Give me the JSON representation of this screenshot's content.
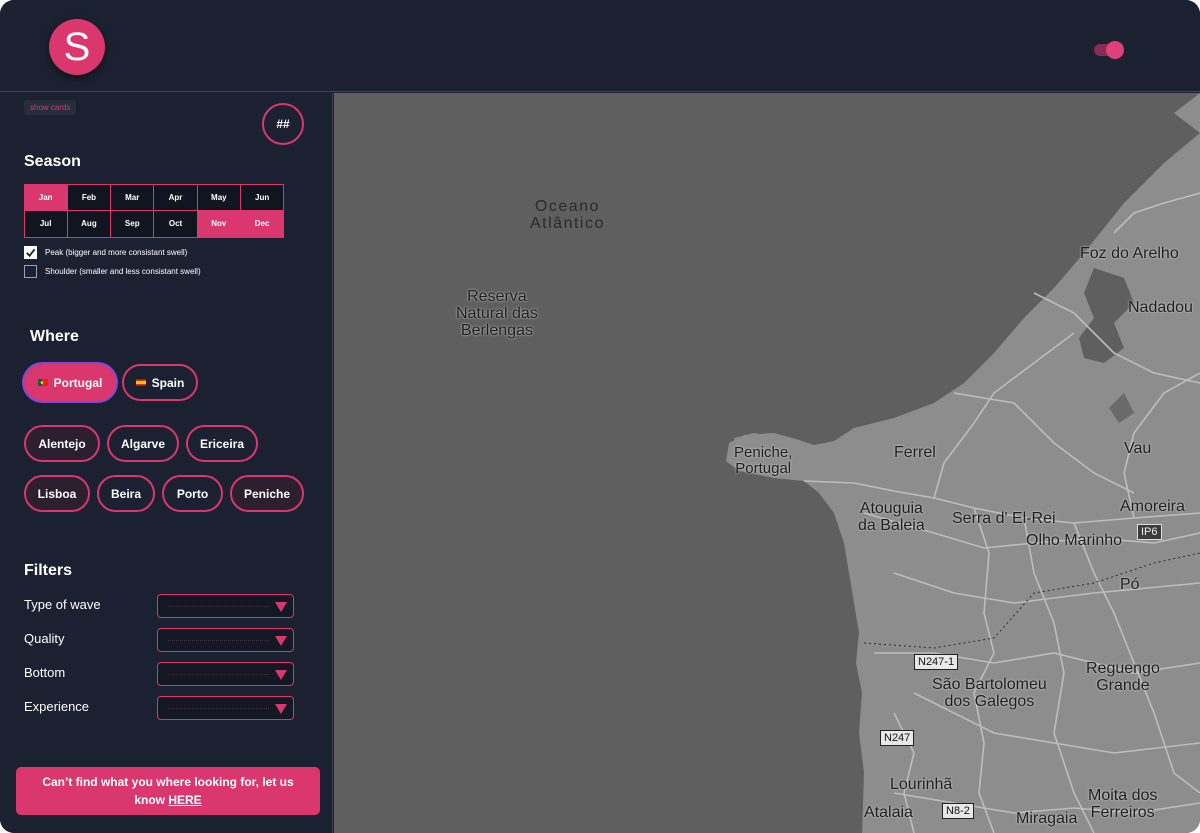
{
  "header": {
    "logo_letter": "S",
    "colors": {
      "accent": "#d9376e",
      "background": "#1b2130"
    }
  },
  "sidebar": {
    "show_cards_label": "show cards",
    "hash_label": "##",
    "season": {
      "title": "Season",
      "months": [
        {
          "label": "Jan",
          "selected": true
        },
        {
          "label": "Feb",
          "selected": false
        },
        {
          "label": "Mar",
          "selected": false
        },
        {
          "label": "Apr",
          "selected": false
        },
        {
          "label": "May",
          "selected": false
        },
        {
          "label": "Jun",
          "selected": false
        },
        {
          "label": "Jul",
          "selected": false
        },
        {
          "label": "Aug",
          "selected": false
        },
        {
          "label": "Sep",
          "selected": false
        },
        {
          "label": "Oct",
          "selected": false
        },
        {
          "label": "Nov",
          "selected": true
        },
        {
          "label": "Dec",
          "selected": true
        }
      ],
      "peak_label": "Peak (bigger and more consistant swell)",
      "peak_checked": true,
      "shoulder_label": "Shoulder (smaller and less consistant swell)",
      "shoulder_checked": false
    },
    "where": {
      "title": "Where",
      "countries": [
        {
          "label": "Portugal",
          "selected": true
        },
        {
          "label": "Spain",
          "selected": false
        }
      ],
      "regions": [
        {
          "label": "Alentejo"
        },
        {
          "label": "Algarve"
        },
        {
          "label": "Ericeira"
        },
        {
          "label": "Lisboa"
        },
        {
          "label": "Beira"
        },
        {
          "label": "Porto"
        },
        {
          "label": "Peniche"
        }
      ]
    },
    "filters": {
      "title": "Filters",
      "items": [
        {
          "label": "Type of wave"
        },
        {
          "label": "Quality"
        },
        {
          "label": "Bottom"
        },
        {
          "label": "Experience"
        }
      ]
    },
    "cta": {
      "text": "Can’t find what you where looking for, let us know ",
      "link": "HERE"
    }
  },
  "map": {
    "labels": {
      "ocean": "Oceano\nAtlântico",
      "berlengas": "Reserva\nNatural das\nBerlengas",
      "peniche": "Peniche,\nPortugal",
      "foz": "Foz do Arelho",
      "nadadou": "Nadadou",
      "vau": "Vau",
      "ferrel": "Ferrel",
      "atouguia": "Atouguia\nda Baleia",
      "serra": "Serra d' El-Rei",
      "amoreira": "Amoreira",
      "olho": "Olho Marinho",
      "po": "Pó",
      "reguengo": "Reguengo\nGrande",
      "sao": "São Bartolomeu\ndos Galegos",
      "lourinha": "Lourinhã",
      "atalaia": "Atalaia",
      "miragaia": "Miragaia",
      "moita": "Moita dos\nFerreiros"
    },
    "roads": {
      "ip6": "IP6",
      "n2471": "N247-1",
      "n247": "N247",
      "n82": "N8-2"
    }
  }
}
